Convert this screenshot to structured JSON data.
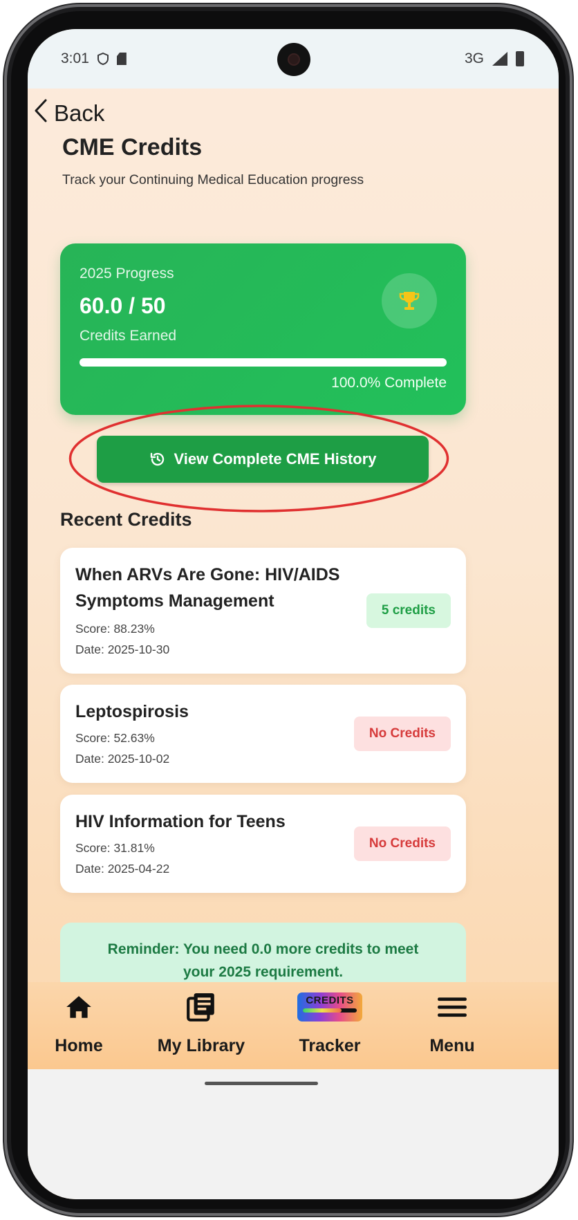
{
  "status_bar": {
    "time": "3:01",
    "network": "3G",
    "icons": [
      "shield-icon",
      "sd-card-icon",
      "signal-icon",
      "battery-icon"
    ]
  },
  "header": {
    "back_label": "Back",
    "title": "CME Credits",
    "subtitle": "Track your Continuing Medical Education progress"
  },
  "progress_card": {
    "year_label": "2025 Progress",
    "value": "60.0 / 50",
    "caption": "Credits Earned",
    "percent_label": "100.0% Complete",
    "percent": 100,
    "icon": "trophy-icon",
    "colors": {
      "card": "#22b75a",
      "trophy": "#f5c518"
    }
  },
  "history_button": {
    "label": "View Complete CME History",
    "icon": "history-icon",
    "highlight_color": "#e03030"
  },
  "recent": {
    "title": "Recent Credits",
    "items": [
      {
        "title_line1": "When ARVs Are Gone: HIV/AIDS",
        "title_line2": "Symptoms Management",
        "score": "Score: 88.23%",
        "date": "Date: 2025-10-30",
        "badge": "5 credits",
        "badge_status": "earned"
      },
      {
        "title_line1": "Leptospirosis",
        "score": "Score: 52.63%",
        "date": "Date: 2025-10-02",
        "badge": "No Credits",
        "badge_status": "none"
      },
      {
        "title_line1": "HIV Information for Teens",
        "score": "Score: 31.81%",
        "date": "Date: 2025-04-22",
        "badge": "No Credits",
        "badge_status": "none"
      }
    ]
  },
  "reminder": {
    "line1": "Reminder: You need 0.0 more credits to meet",
    "line2": "your 2025 requirement."
  },
  "bottom_nav": {
    "items": [
      {
        "label": "Home",
        "icon": "home-icon"
      },
      {
        "label": "My Library",
        "icon": "library-icon"
      },
      {
        "label": "Tracker",
        "icon": "credits-tracker-icon",
        "icon_text": "CREDITS"
      },
      {
        "label": "Menu",
        "icon": "menu-icon"
      }
    ]
  }
}
